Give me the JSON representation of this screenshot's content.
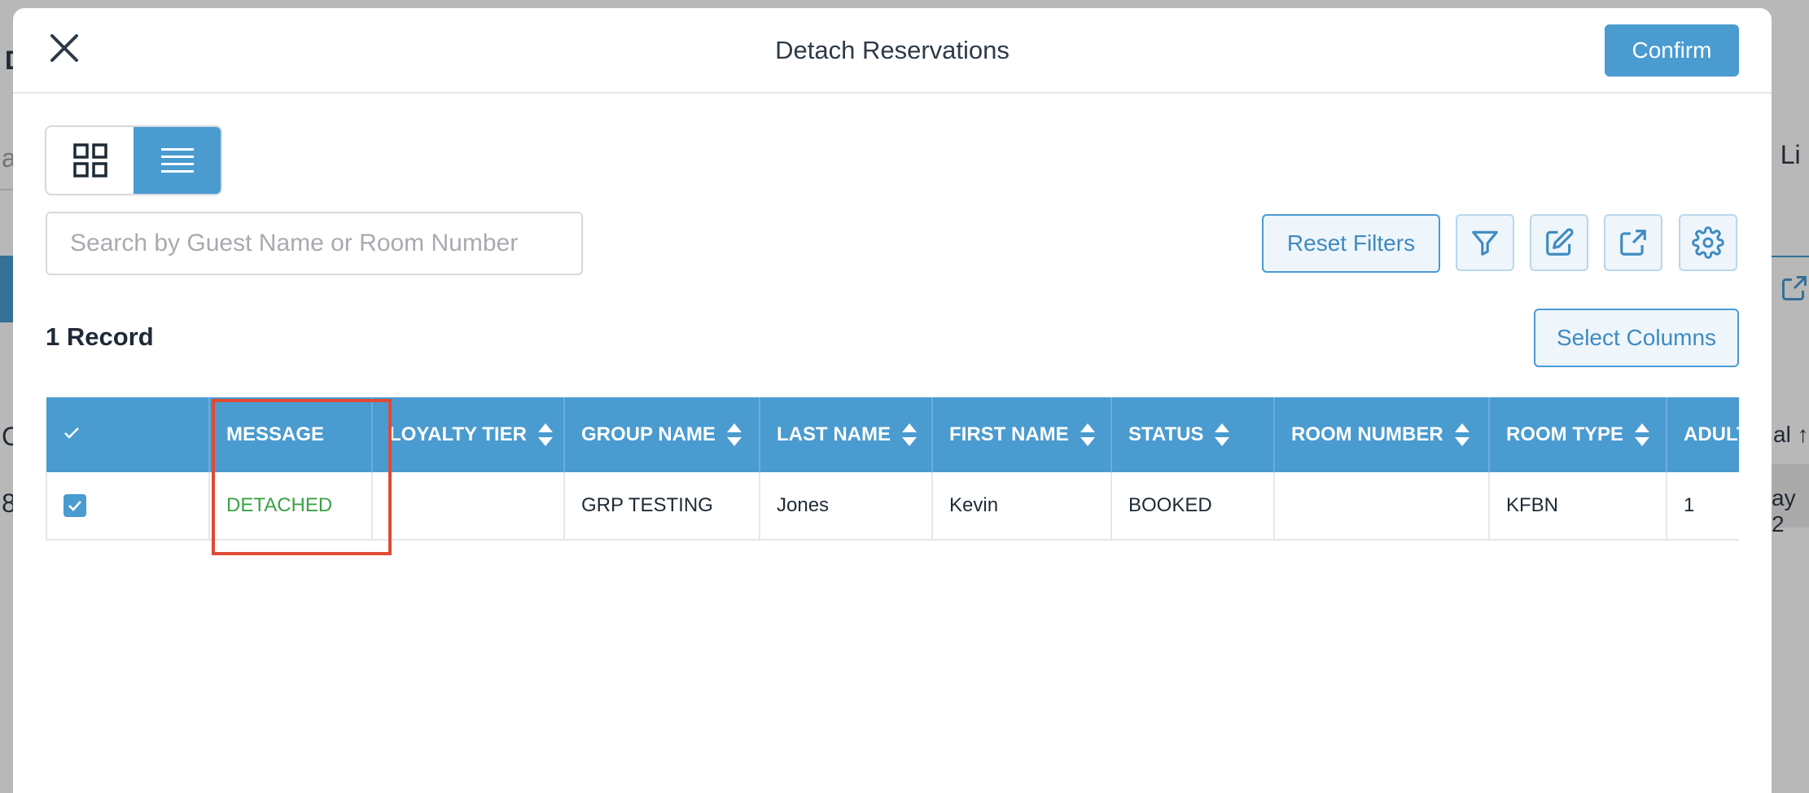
{
  "background": {
    "frag_left_1": "D",
    "frag_left_2": "a",
    "frag_left_3": "C",
    "frag_left_4": "8",
    "frag_right_1": "g Li",
    "frag_right_2": "al ↑",
    "frag_right_3": "ay 2"
  },
  "modal": {
    "title": "Detach Reservations",
    "confirm_label": "Confirm"
  },
  "search": {
    "placeholder": "Search by Guest Name or Room Number",
    "value": ""
  },
  "toolbar": {
    "reset_filters_label": "Reset Filters",
    "icons": [
      "filter-icon",
      "edit-icon",
      "export-icon",
      "settings-icon"
    ]
  },
  "records": {
    "count_label": "1 Record",
    "select_columns_label": "Select Columns"
  },
  "table": {
    "headers": [
      "MESSAGE",
      "LOYALTY TIER",
      "GROUP NAME",
      "LAST NAME",
      "FIRST NAME",
      "STATUS",
      "ROOM NUMBER",
      "ROOM TYPE",
      "ADULT"
    ],
    "rows": [
      {
        "message": "DETACHED",
        "loyalty_tier": "",
        "group_name": "GRP TESTING",
        "last_name": "Jones",
        "first_name": "Kevin",
        "status": "BOOKED",
        "room_number": "",
        "room_type": "KFBN",
        "adults": "1"
      }
    ]
  },
  "colors": {
    "accent": "#4a9bd0",
    "success": "#3aa244",
    "highlight": "#e04a33"
  }
}
